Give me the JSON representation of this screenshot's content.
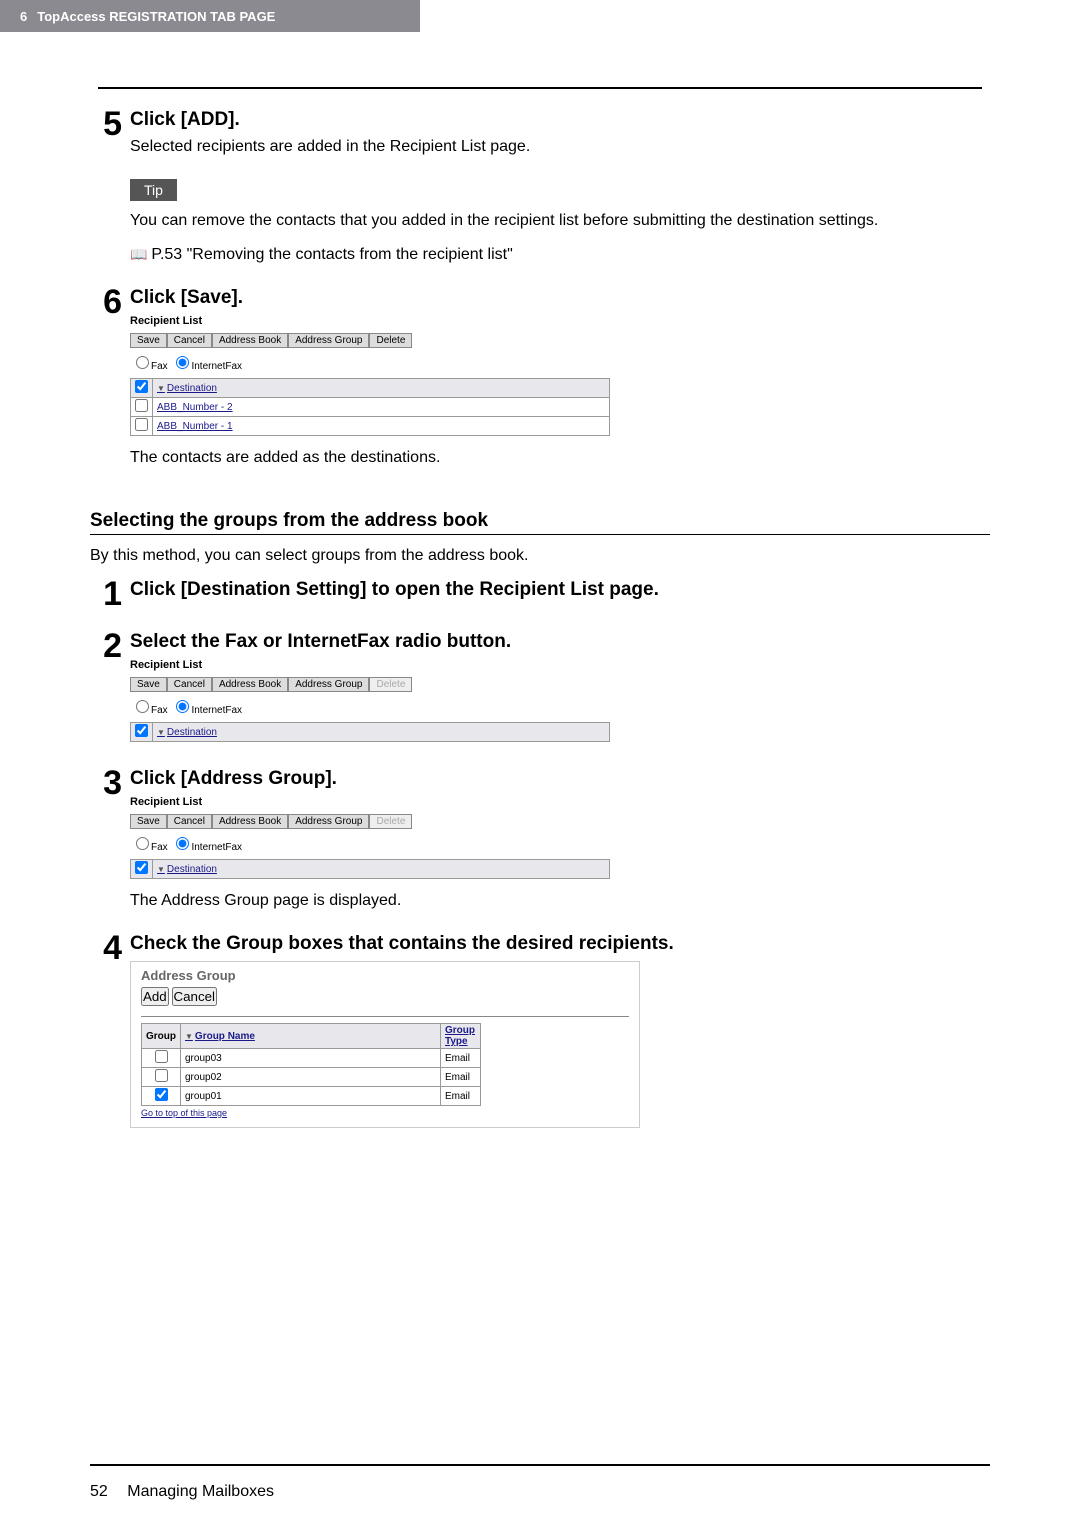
{
  "header": {
    "chapter": "6",
    "title": "TopAccess REGISTRATION TAB PAGE"
  },
  "step5": {
    "title": "Click [ADD].",
    "text1": "Selected recipients are added in the Recipient List page.",
    "tip_label": "Tip",
    "tip_text": "You can remove the contacts that you added in the recipient list before submitting the destination settings.",
    "ref": "P.53 \"Removing the contacts from the recipient list\""
  },
  "step6": {
    "title": "Click [Save].",
    "rl": {
      "title": "Recipient List",
      "btn_save": "Save",
      "btn_cancel": "Cancel",
      "btn_ab": "Address Book",
      "btn_ag": "Address Group",
      "btn_del": "Delete",
      "radio_fax": "Fax",
      "radio_ifax": "InternetFax",
      "col_dest": "Destination",
      "rows": [
        {
          "name": "ABB_Number - 2"
        },
        {
          "name": "ABB_Number - 1"
        }
      ]
    },
    "after": "The contacts are added as the destinations."
  },
  "subsection": {
    "title": "Selecting the groups from the address book",
    "intro": "By this method, you can select groups from the address book."
  },
  "g_step1": {
    "title": "Click [Destination Setting] to open the Recipient List page."
  },
  "g_step2": {
    "title": "Select the Fax or InternetFax radio button.",
    "rl": {
      "title": "Recipient List",
      "btn_save": "Save",
      "btn_cancel": "Cancel",
      "btn_ab": "Address Book",
      "btn_ag": "Address Group",
      "btn_del": "Delete",
      "radio_fax": "Fax",
      "radio_ifax": "InternetFax",
      "col_dest": "Destination"
    }
  },
  "g_step3": {
    "title": "Click [Address Group].",
    "rl": {
      "title": "Recipient List",
      "btn_save": "Save",
      "btn_cancel": "Cancel",
      "btn_ab": "Address Book",
      "btn_ag": "Address Group",
      "btn_del": "Delete",
      "radio_fax": "Fax",
      "radio_ifax": "InternetFax",
      "col_dest": "Destination"
    },
    "after": "The Address Group page is displayed."
  },
  "g_step4": {
    "title": "Check the Group boxes that contains the desired recipients.",
    "ag": {
      "title": "Address Group",
      "btn_add": "Add",
      "btn_cancel": "Cancel",
      "col_group": "Group",
      "col_name": "Group Name",
      "col_type": "Group Type",
      "rows": [
        {
          "checked": false,
          "name": "group03",
          "type": "Email"
        },
        {
          "checked": false,
          "name": "group02",
          "type": "Email"
        },
        {
          "checked": true,
          "name": "group01",
          "type": "Email"
        }
      ],
      "gotop": "Go to top of this page"
    }
  },
  "footer": {
    "page": "52",
    "section": "Managing Mailboxes"
  }
}
